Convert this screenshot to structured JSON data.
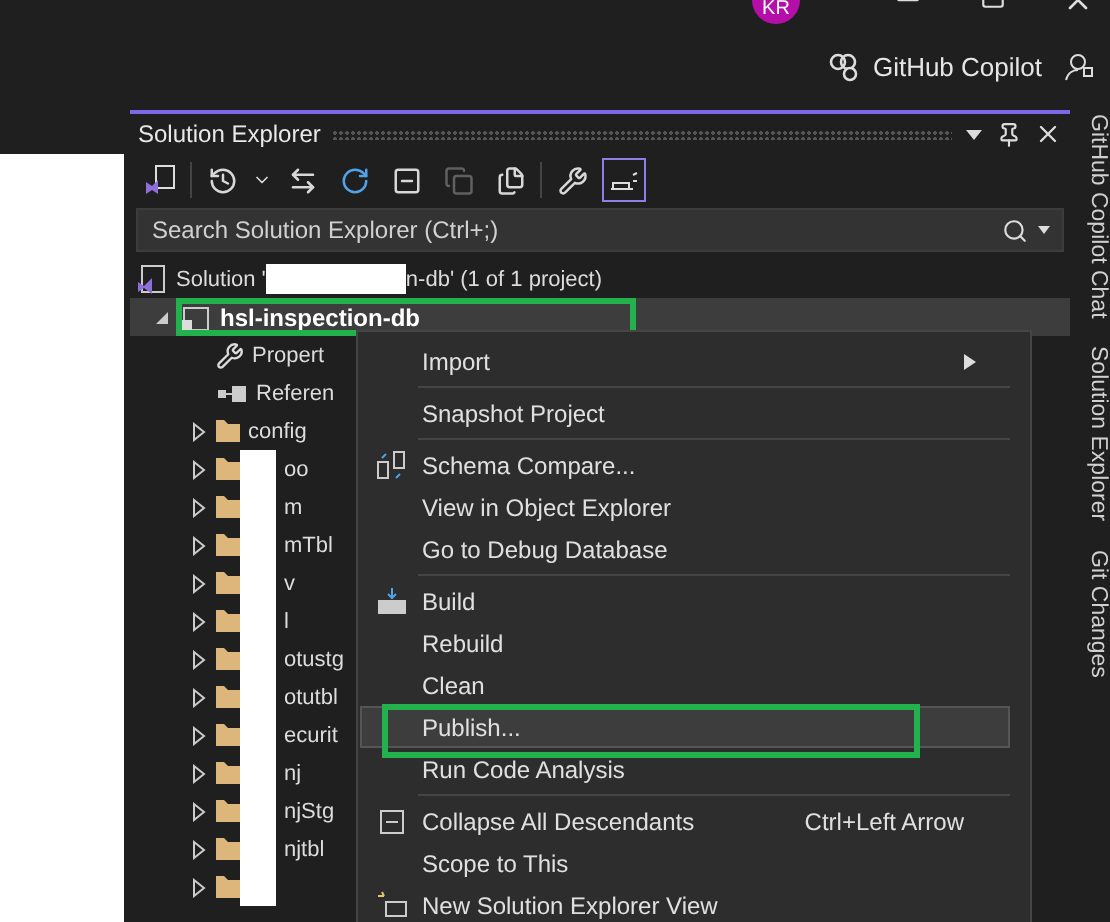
{
  "title_bar": {
    "avatar": "KR",
    "copilot_button": "GitHub Copilot"
  },
  "panel": {
    "title": "Solution Explorer",
    "toolbar": [
      {
        "kind": "switch-views",
        "selected": false,
        "disabled": false
      },
      {
        "kind": "separator"
      },
      {
        "kind": "history",
        "selected": false,
        "disabled": false
      },
      {
        "kind": "sync",
        "selected": false,
        "disabled": false
      },
      {
        "kind": "refresh",
        "selected": false,
        "disabled": false
      },
      {
        "kind": "collapse",
        "selected": false,
        "disabled": false
      },
      {
        "kind": "copy",
        "selected": false,
        "disabled": true
      },
      {
        "kind": "show-files",
        "selected": false,
        "disabled": false
      },
      {
        "kind": "separator"
      },
      {
        "kind": "properties",
        "selected": false,
        "disabled": false
      },
      {
        "kind": "preview",
        "selected": true,
        "disabled": false
      }
    ],
    "search": {
      "placeholder": "Search Solution Explorer (Ctrl+;)"
    },
    "tree": [
      {
        "kind": "solution",
        "prefix": "Solution '",
        "suffix": "n-db' (1 of 1 project)",
        "redacted": true,
        "selected": false,
        "annotated": false,
        "children": [
          {
            "kind": "project",
            "label": "hsl-inspection-db",
            "expanded": true,
            "selected": true,
            "annotated": true,
            "children": [
              {
                "kind": "properties",
                "label": "Propert",
                "selected": false,
                "annotated": false
              },
              {
                "kind": "references",
                "label": "Referen",
                "selected": false,
                "annotated": false
              },
              {
                "kind": "folder",
                "label": "config",
                "expanded": false,
                "redacted": false,
                "selected": false,
                "annotated": false
              },
              {
                "kind": "folder",
                "label": "oo",
                "expanded": false,
                "redacted": true,
                "selected": false,
                "annotated": false
              },
              {
                "kind": "folder",
                "label": "m",
                "expanded": false,
                "redacted": true,
                "selected": false,
                "annotated": false
              },
              {
                "kind": "folder",
                "label": "mTbl",
                "expanded": false,
                "redacted": true,
                "selected": false,
                "annotated": false
              },
              {
                "kind": "folder",
                "label": "v",
                "expanded": false,
                "redacted": true,
                "selected": false,
                "annotated": false
              },
              {
                "kind": "folder",
                "label": "l",
                "expanded": false,
                "redacted": true,
                "selected": false,
                "annotated": false
              },
              {
                "kind": "folder",
                "label": "otustg",
                "expanded": false,
                "redacted": true,
                "selected": false,
                "annotated": false
              },
              {
                "kind": "folder",
                "label": "otutbl",
                "expanded": false,
                "redacted": true,
                "selected": false,
                "annotated": false
              },
              {
                "kind": "folder",
                "label": "ecurit",
                "expanded": false,
                "redacted": true,
                "selected": false,
                "annotated": false
              },
              {
                "kind": "folder",
                "label": "nj",
                "expanded": false,
                "redacted": true,
                "selected": false,
                "annotated": false
              },
              {
                "kind": "folder",
                "label": "njStg",
                "expanded": false,
                "redacted": true,
                "selected": false,
                "annotated": false
              },
              {
                "kind": "folder",
                "label": "njtbl",
                "expanded": false,
                "redacted": true,
                "selected": false,
                "annotated": false
              },
              {
                "kind": "folder",
                "expanded": false,
                "redacted": true,
                "selected": false,
                "annotated": false
              }
            ]
          }
        ]
      }
    ],
    "context_menu": [
      {
        "kind": "item",
        "label": "Import",
        "submenu": true,
        "selected": false,
        "annotated": false
      },
      {
        "kind": "separator"
      },
      {
        "kind": "item",
        "label": "Snapshot Project",
        "selected": false,
        "annotated": false
      },
      {
        "kind": "separator"
      },
      {
        "kind": "compare",
        "label": "Schema Compare...",
        "selected": false,
        "annotated": false
      },
      {
        "kind": "item",
        "label": "View in Object Explorer",
        "selected": false,
        "annotated": false
      },
      {
        "kind": "item",
        "label": "Go to Debug Database",
        "selected": false,
        "annotated": false
      },
      {
        "kind": "separator"
      },
      {
        "kind": "build",
        "label": "Build",
        "selected": false,
        "annotated": false
      },
      {
        "kind": "item",
        "label": "Rebuild",
        "selected": false,
        "annotated": false
      },
      {
        "kind": "item",
        "label": "Clean",
        "selected": false,
        "annotated": false
      },
      {
        "kind": "item",
        "label": "Publish...",
        "selected": true,
        "annotated": true
      },
      {
        "kind": "item",
        "label": "Run Code Analysis",
        "selected": false,
        "annotated": false
      },
      {
        "kind": "separator"
      },
      {
        "kind": "collapse",
        "label": "Collapse All Descendants",
        "shortcut": "Ctrl+Left Arrow",
        "selected": false,
        "annotated": false
      },
      {
        "kind": "item",
        "label": "Scope to This",
        "selected": false,
        "annotated": false
      },
      {
        "kind": "new-view",
        "label": "New Solution Explorer View",
        "selected": false,
        "annotated": false
      }
    ]
  },
  "side_tabs": [
    "GitHub Copilot Chat",
    "Solution Explorer",
    "Git Changes"
  ]
}
